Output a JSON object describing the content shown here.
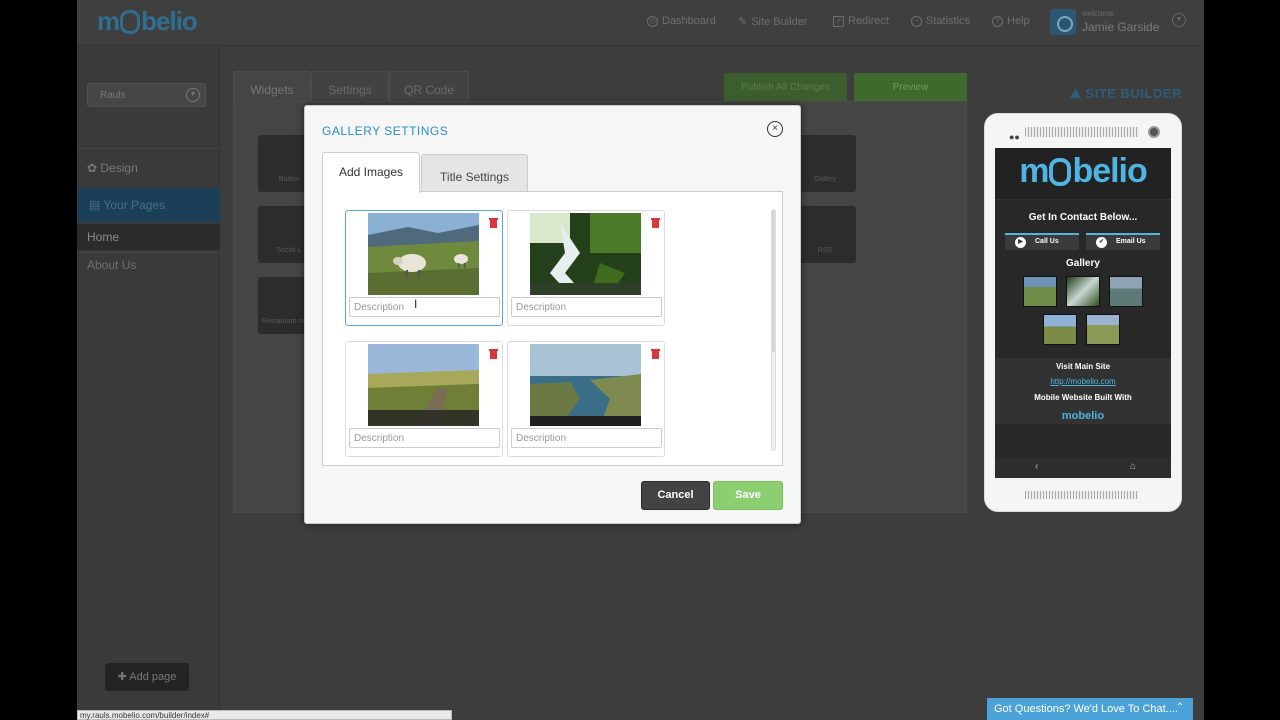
{
  "app": {
    "logo": "mobelio",
    "nav": [
      {
        "label": "Dashboard",
        "icon": "clock-icon"
      },
      {
        "label": "Site Builder",
        "icon": "pencil-icon"
      },
      {
        "label": "Redirect",
        "icon": "redirect-icon"
      },
      {
        "label": "Statistics",
        "icon": "pie-chart-icon"
      },
      {
        "label": "Help",
        "icon": "help-icon"
      }
    ],
    "user": {
      "welcome": "welcome",
      "name": "Jamie Garside"
    }
  },
  "sidebar": {
    "site": "Rauls",
    "design": "Design",
    "your_pages": "Your Pages",
    "pages": [
      "Home",
      "About Us"
    ],
    "add_page": "Add page"
  },
  "workspace": {
    "tabs": [
      "Widgets",
      "Settings",
      "QR Code"
    ],
    "publish": "Publish All Changes",
    "preview": "Preview",
    "site_builder": "SITE BUILDER",
    "widgets": [
      "Button",
      "Gallery",
      "Social L",
      "RSS",
      "Restaurant menu"
    ]
  },
  "phone": {
    "logo": "mobelio",
    "contact_heading": "Get In Contact Below...",
    "call_us": "Call Us",
    "email_us": "Email Us",
    "gallery": "Gallery",
    "visit_main": "Visit Main Site",
    "link": "http://mobelio.com",
    "built_with": "Mobile Website Built With",
    "small_logo": "mobelio"
  },
  "modal": {
    "title": "GALLERY SETTINGS",
    "tabs": [
      "Add Images",
      "Title Settings"
    ],
    "images": [
      {
        "desc_placeholder": "Description",
        "scene": "sheep-on-hillside"
      },
      {
        "desc_placeholder": "Description",
        "scene": "waterfall-forest"
      },
      {
        "desc_placeholder": "Description",
        "scene": "country-road-fields"
      },
      {
        "desc_placeholder": "Description",
        "scene": "coastal-cliffs"
      }
    ],
    "cancel": "Cancel",
    "save": "Save"
  },
  "chat": "Got Questions? We'd Love To Chat....",
  "status_url": "my.rauls.mobelio.com/builder/index#"
}
